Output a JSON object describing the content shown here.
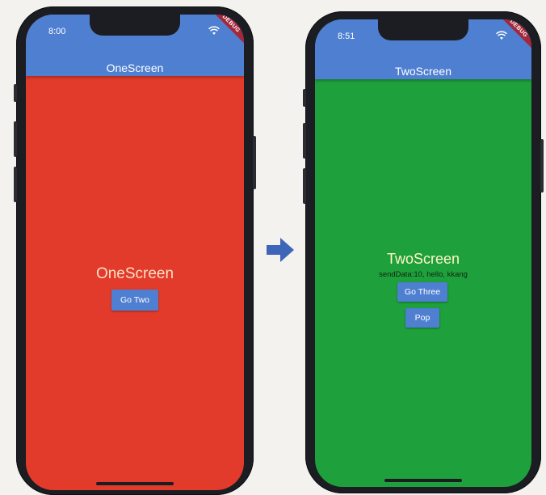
{
  "left_phone": {
    "status_time": "8:00",
    "appbar_title": "OneScreen",
    "debug_banner": "DEBUG",
    "body_title": "OneScreen",
    "button_label": "Go Two",
    "background_color": "#e23b2b"
  },
  "right_phone": {
    "status_time": "8:51",
    "appbar_title": "TwoScreen",
    "debug_banner": "DEBUG",
    "body_title": "TwoScreen",
    "send_data": "sendData:10, hello, kkang",
    "button_label": "Go Three",
    "pop_label": "Pop",
    "background_color": "#1ea03c"
  },
  "colors": {
    "appbar": "#4f7fd0",
    "arrow": "#3e66b8",
    "frame": "#1b1d22"
  },
  "icons": {
    "status": "wifi-icon",
    "transition": "arrow-right-icon"
  }
}
